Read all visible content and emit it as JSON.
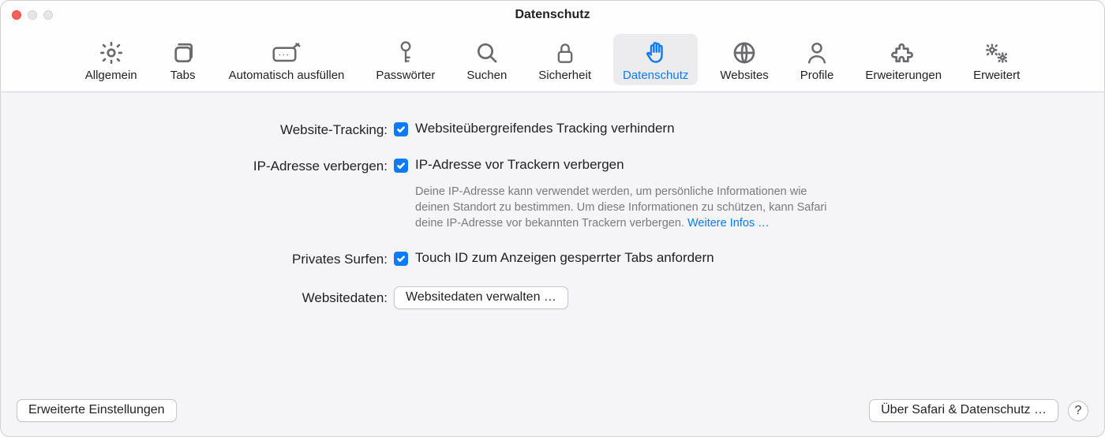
{
  "window": {
    "title": "Datenschutz"
  },
  "tabs": [
    {
      "label": "Allgemein"
    },
    {
      "label": "Tabs"
    },
    {
      "label": "Automatisch ausfüllen"
    },
    {
      "label": "Passwörter"
    },
    {
      "label": "Suchen"
    },
    {
      "label": "Sicherheit"
    },
    {
      "label": "Datenschutz"
    },
    {
      "label": "Websites"
    },
    {
      "label": "Profile"
    },
    {
      "label": "Erweiterungen"
    },
    {
      "label": "Erweitert"
    }
  ],
  "rows": {
    "tracking": {
      "label": "Website-Tracking:",
      "option": "Websiteübergreifendes Tracking verhindern"
    },
    "ip": {
      "label": "IP-Adresse verbergen:",
      "option": "IP-Adresse vor Trackern verbergen",
      "help": "Deine IP-Adresse kann verwendet werden, um persönliche Informationen wie deinen Standort zu bestimmen. Um diese Informationen zu schützen, kann Safari deine IP-Adresse vor bekannten Trackern verbergen. ",
      "help_link": "Weitere Infos …"
    },
    "private": {
      "label": "Privates Surfen:",
      "option": "Touch ID zum Anzeigen gesperrter Tabs anfordern"
    },
    "webdata": {
      "label": "Websitedaten:",
      "button": "Websitedaten verwalten …"
    }
  },
  "footer": {
    "advanced": "Erweiterte Einstellungen",
    "about": "Über Safari & Datenschutz …",
    "help": "?"
  }
}
